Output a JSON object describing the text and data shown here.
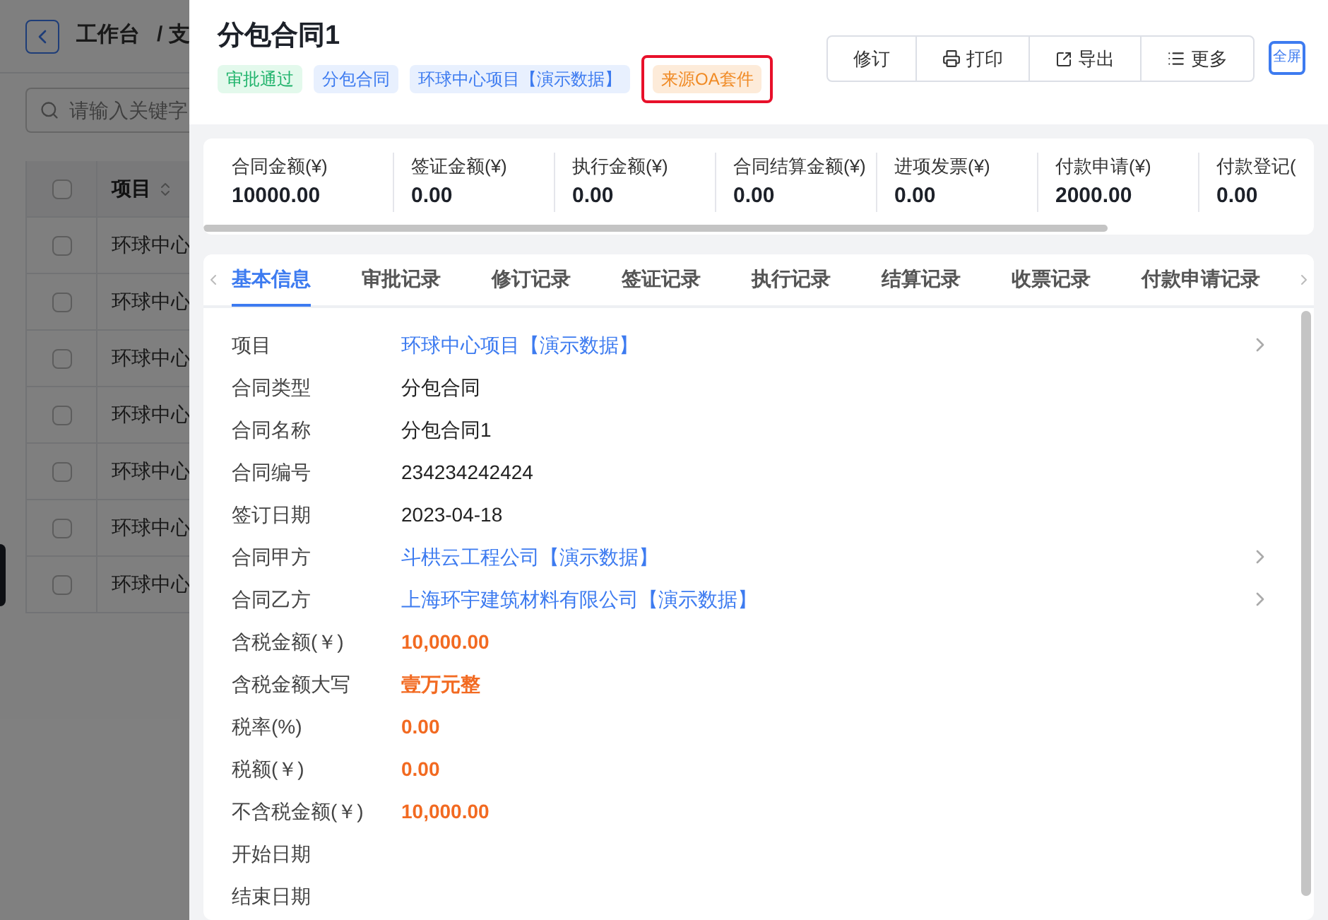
{
  "background_page": {
    "breadcrumb": [
      "工作台",
      "/ 支"
    ],
    "search": {
      "placeholder": "请输入关键字"
    },
    "table": {
      "select_all_checked": false,
      "columns": [
        "项目"
      ],
      "rows": [
        {
          "checked": false,
          "cells": [
            "环球中心"
          ]
        },
        {
          "checked": false,
          "cells": [
            "环球中心"
          ]
        },
        {
          "checked": false,
          "cells": [
            "环球中心"
          ]
        },
        {
          "checked": false,
          "cells": [
            "环球中心"
          ]
        },
        {
          "checked": false,
          "cells": [
            "环球中心"
          ]
        },
        {
          "checked": false,
          "cells": [
            "环球中心"
          ]
        },
        {
          "checked": false,
          "cells": [
            "环球中心"
          ]
        }
      ]
    }
  },
  "drawer": {
    "title": "分包合同1",
    "tags": [
      {
        "label": "审批通过",
        "kind": "success",
        "highlighted": false
      },
      {
        "label": "分包合同",
        "kind": "info",
        "highlighted": false
      },
      {
        "label": "环球中心项目【演示数据】",
        "kind": "info",
        "highlighted": false
      },
      {
        "label": "来源OA套件",
        "kind": "warning",
        "highlighted": true
      }
    ],
    "actions": [
      {
        "label": "修订"
      },
      {
        "label": "打印"
      },
      {
        "label": "导出"
      },
      {
        "label": "更多"
      }
    ],
    "fullscreen": "全屏",
    "stats": [
      {
        "label": "合同金额(¥)",
        "value": "10000.00"
      },
      {
        "label": "签证金额(¥)",
        "value": "0.00"
      },
      {
        "label": "执行金额(¥)",
        "value": "0.00"
      },
      {
        "label": "合同结算金额(¥)",
        "value": "0.00"
      },
      {
        "label": "进项发票(¥)",
        "value": "0.00"
      },
      {
        "label": "付款申请(¥)",
        "value": "2000.00"
      },
      {
        "label": "付款登记(",
        "value": "0.00"
      }
    ],
    "tabs": [
      {
        "label": "基本信息",
        "selected": true
      },
      {
        "label": "审批记录",
        "selected": false
      },
      {
        "label": "修订记录",
        "selected": false
      },
      {
        "label": "签证记录",
        "selected": false
      },
      {
        "label": "执行记录",
        "selected": false
      },
      {
        "label": "结算记录",
        "selected": false
      },
      {
        "label": "收票记录",
        "selected": false
      },
      {
        "label": "付款申请记录",
        "selected": false
      }
    ],
    "fields": [
      {
        "label": "项目",
        "value": "环球中心项目【演示数据】",
        "kind": "link"
      },
      {
        "label": "合同类型",
        "value": "分包合同",
        "kind": "plain"
      },
      {
        "label": "合同名称",
        "value": "分包合同1",
        "kind": "plain"
      },
      {
        "label": "合同编号",
        "value": "234234242424",
        "kind": "plain"
      },
      {
        "label": "签订日期",
        "value": "2023-04-18",
        "kind": "plain"
      },
      {
        "label": "合同甲方",
        "value": "斗栱云工程公司【演示数据】",
        "kind": "link"
      },
      {
        "label": "合同乙方",
        "value": "上海环宇建筑材料有限公司【演示数据】",
        "kind": "link"
      },
      {
        "label": "含税金额(￥)",
        "value": "10,000.00",
        "kind": "amount"
      },
      {
        "label": "含税金额大写",
        "value": "壹万元整",
        "kind": "amount"
      },
      {
        "label": "税率(%)",
        "value": "0.00",
        "kind": "amount"
      },
      {
        "label": "税额(￥)",
        "value": "0.00",
        "kind": "amount"
      },
      {
        "label": "不含税金额(￥)",
        "value": "10,000.00",
        "kind": "amount"
      },
      {
        "label": "开始日期",
        "kind": "plain"
      },
      {
        "label": "结束日期",
        "kind": "plain"
      }
    ]
  }
}
